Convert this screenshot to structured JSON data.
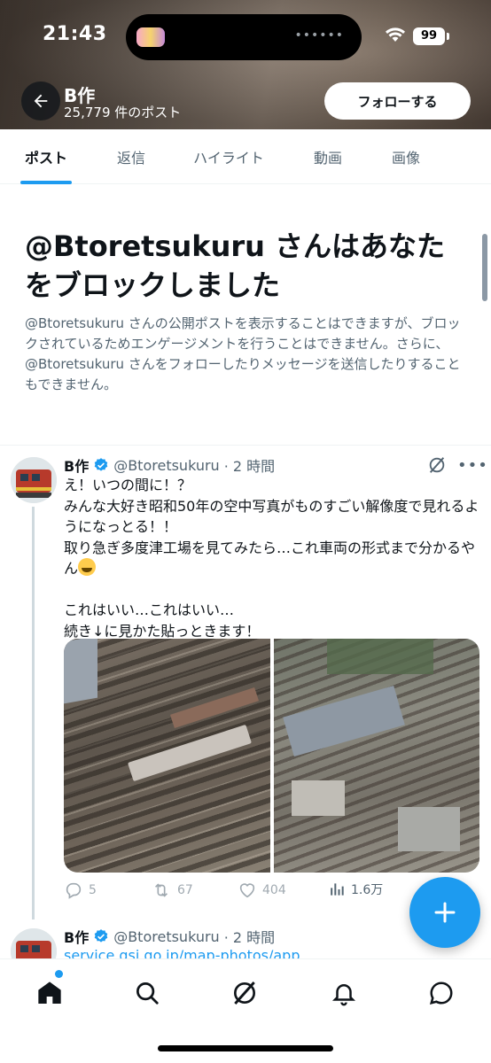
{
  "status_bar": {
    "time": "21:43",
    "battery": "99"
  },
  "header": {
    "name": "B作",
    "post_count": "25,779 件のポスト",
    "follow_label": "フォローする"
  },
  "tabs": [
    {
      "label": "ポスト",
      "active": true
    },
    {
      "label": "返信",
      "active": false
    },
    {
      "label": "ハイライト",
      "active": false
    },
    {
      "label": "動画",
      "active": false
    },
    {
      "label": "画像",
      "active": false
    }
  ],
  "blocked": {
    "title": "@Btoretsukuru さんはあなたをブロックしました",
    "description": "@Btoretsukuru さんの公開ポストを表示することはできますが、ブロックされているためエンゲージメントを行うことはできません。さらに、@Btoretsukuru さんをフォローしたりメッセージを送信したりすることもできません。"
  },
  "tweet1": {
    "name": "B作",
    "handle": "@Btoretsukuru",
    "time": "· 2 時間",
    "text_before_emoji": "え！いつの間に！？\nみんな大好き昭和50年の空中写真がものすごい解像度で見れるようになっとる！！\n取り急ぎ多度津工場を見てみたら…これ車両の形式まで分かるやん",
    "text_after_emoji": "\n\nこれはいい…これはいい…\n続き↓に見かた貼っときます！",
    "replies": "5",
    "reposts": "67",
    "likes": "404",
    "views": "1.6万"
  },
  "tweet2": {
    "name": "B作",
    "handle": "@Btoretsukuru",
    "time": "· 2 時間",
    "link": "service.gsi.go.jp/map-photos/app"
  },
  "colors": {
    "accent": "#1d9bf0",
    "text": "#0f1419",
    "secondary": "#536471"
  }
}
